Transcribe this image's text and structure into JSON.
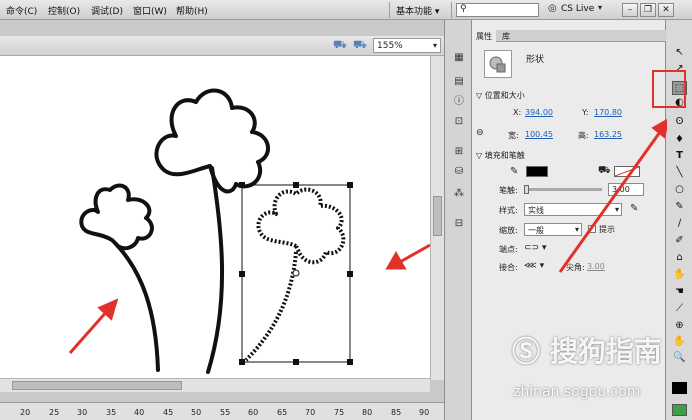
{
  "menubar": {
    "items": [
      "命令(C)",
      "控制(O)",
      "调试(D)",
      "窗口(W)",
      "帮助(H)"
    ],
    "workspace": "基本功能 ▾",
    "cs_live": "CS Live"
  },
  "document": {
    "zoom": "155%"
  },
  "ruler": {
    "ticks": [
      "20",
      "25",
      "30",
      "35",
      "40",
      "45",
      "50",
      "55",
      "60",
      "65",
      "70",
      "75",
      "80",
      "85",
      "90"
    ]
  },
  "properties": {
    "tabs": [
      "属性",
      "库"
    ],
    "object_type": "形状",
    "section_position": "位置和大小",
    "x_label": "X:",
    "x_value": "394.00",
    "y_label": "Y:",
    "y_value": "170.80",
    "w_label": "宽:",
    "w_value": "100.45",
    "h_label": "高:",
    "h_value": "163.25",
    "section_fill": "填充和笔触",
    "stroke_label": "笔触:",
    "stroke_value": "3.00",
    "style_label": "样式:",
    "style_value": "实线",
    "scale_label": "缩放:",
    "scale_value": "一般",
    "hint_label": "提示",
    "cap_label": "端点:",
    "join_label": "接合:",
    "miter_label": "尖角:",
    "miter_value": "3.00"
  },
  "tools": [
    "↖",
    "↗",
    "⬚",
    "◐",
    "ʘ",
    "♦",
    "T",
    "╲",
    "○",
    "✎",
    "∕",
    "✐",
    "⌂",
    "✋",
    "☚",
    "⟋",
    "⊕",
    "✋",
    "🔍"
  ],
  "watermark": {
    "brand": "搜狗指南",
    "url": "zhinan.sogou.com"
  },
  "colors": {
    "accent_red": "#e0322b",
    "link_blue": "#1f5fb5"
  }
}
